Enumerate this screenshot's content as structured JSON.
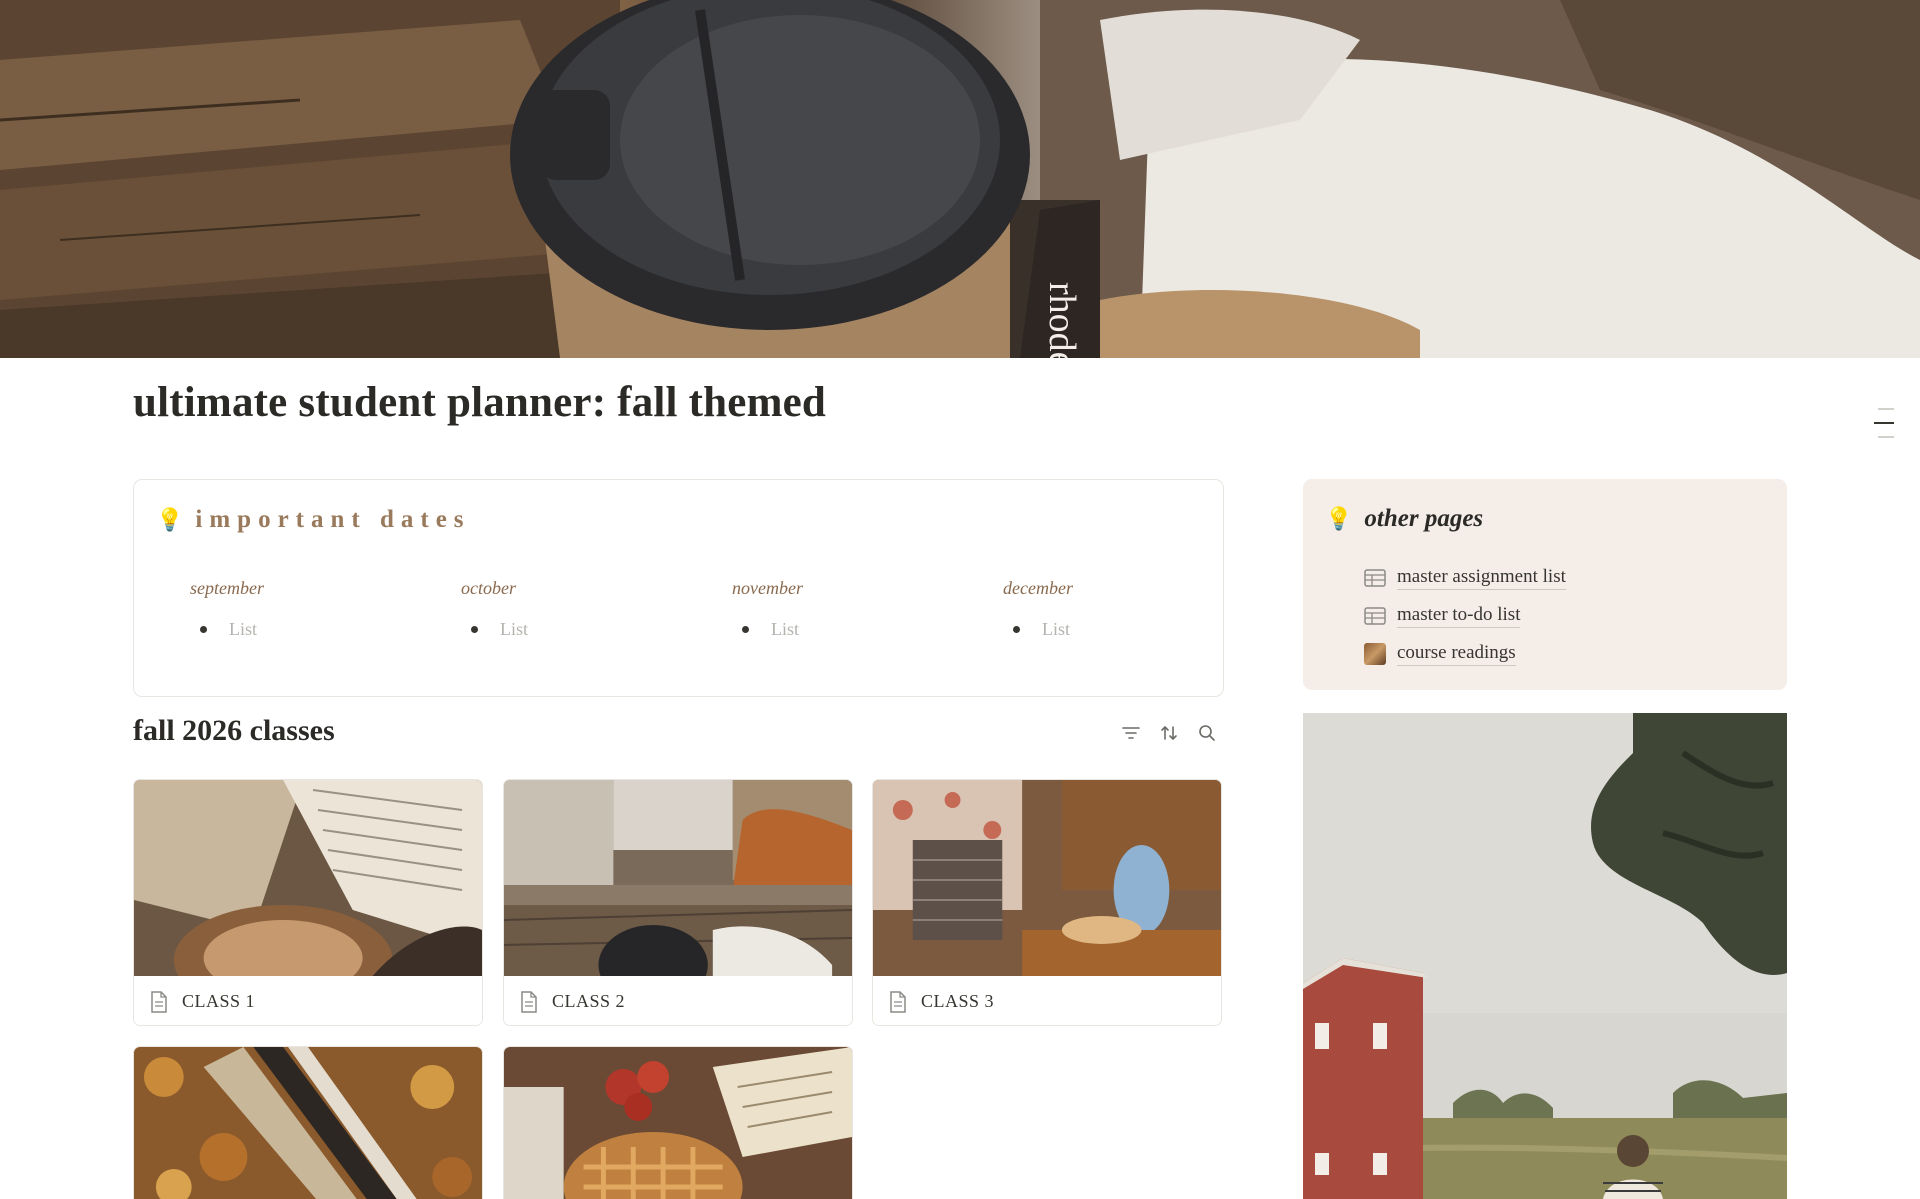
{
  "cover": {
    "image": "coffee-cup-cover-photo",
    "cup_text": "rhode"
  },
  "page": {
    "title": "ultimate student planner: fall themed"
  },
  "important_dates": {
    "icon": "lightbulb-icon",
    "title": "important dates",
    "months": [
      {
        "name": "september",
        "placeholder": "List"
      },
      {
        "name": "october",
        "placeholder": "List"
      },
      {
        "name": "november",
        "placeholder": "List"
      },
      {
        "name": "december",
        "placeholder": "List"
      }
    ]
  },
  "classes": {
    "title": "fall 2026 classes",
    "tools": [
      "filter-icon",
      "sort-icon",
      "search-icon"
    ],
    "cards": [
      {
        "label": "CLASS 1",
        "image": "book-and-latte"
      },
      {
        "label": "CLASS 2",
        "image": "city-street-coffee"
      },
      {
        "label": "CLASS 3",
        "image": "bakery-interior"
      },
      {
        "label": "",
        "image": "books-on-autumn-leaves"
      },
      {
        "label": "",
        "image": "apple-pie-and-book"
      }
    ]
  },
  "other_pages": {
    "icon": "lightbulb-icon",
    "title": "other pages",
    "links": [
      {
        "label": "master assignment list",
        "icon": "table-icon"
      },
      {
        "label": "master to-do list",
        "icon": "table-icon"
      },
      {
        "label": "course readings",
        "icon": "page-image-icon"
      }
    ]
  },
  "side_photo": {
    "image": "red-barn-field"
  },
  "colors": {
    "accent": "#9a7a5c",
    "callout_bg": "#f5ede8",
    "border": "#e9e6e1",
    "text": "#37352f"
  }
}
